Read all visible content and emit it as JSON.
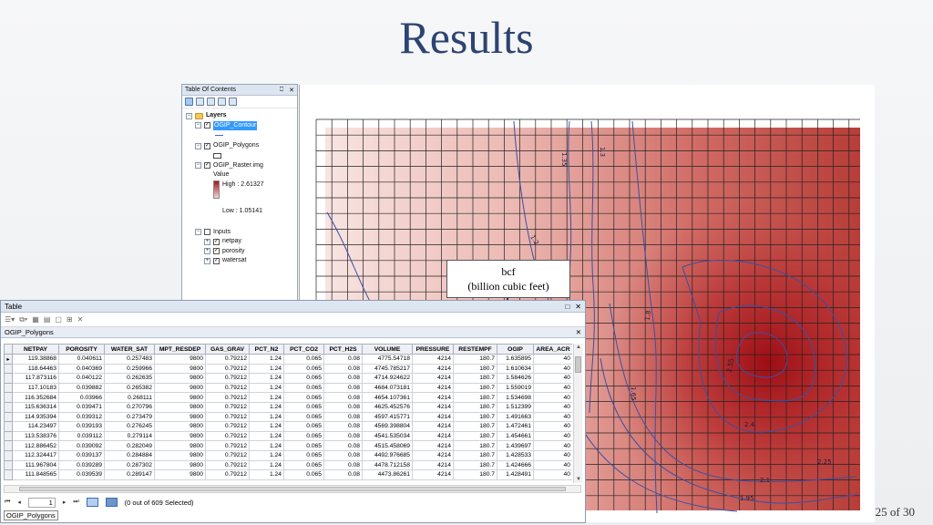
{
  "slide": {
    "title": "Results",
    "page_number": "25 of 30"
  },
  "toc": {
    "title": "Table Of Contents",
    "pin": "⎕",
    "close": "✕",
    "layers_label": "Layers",
    "layer1": "OGIP_Contour",
    "layer2": "OGIP_Polygons",
    "layer3": "OGIP_Raster.img",
    "value_label": "Value",
    "high_label": "High : 2.61327",
    "low_label": "Low : 1.05141",
    "inputs_label": "Inputs",
    "input1": "netpay",
    "input2": "porosity",
    "input3": "watersat"
  },
  "callout": {
    "line1": "bcf",
    "line2": "(billion cubic feet)"
  },
  "map": {
    "colors": {
      "light": "#f6e0dd",
      "dark": "#a5131a",
      "contour": "#3c4fa3",
      "grid": "#222222"
    },
    "contour_labels": [
      "1.35",
      "1.3",
      "1.2",
      "1.8",
      "1.65",
      "2.55",
      "2.4",
      "2.25",
      "2.1",
      "1.95"
    ]
  },
  "table": {
    "window_title": "Table",
    "close": "✕",
    "maximize": "□",
    "layer_tab": "OGIP_Polygons",
    "columns": [
      "",
      "NETPAY",
      "POROSITY",
      "WATER_SAT",
      "MPT_RESDEP",
      "GAS_GRAV",
      "PCT_N2",
      "PCT_CO2",
      "PCT_H2S",
      "VOLUME",
      "PRESSURE",
      "RESTEMPF",
      "OGIP",
      "AREA_ACR"
    ],
    "rows": [
      [
        "▸",
        "119.38868",
        "0.040611",
        "0.257483",
        "9800",
        "0.79212",
        "1.24",
        "0.065",
        "0.08",
        "4775.54718",
        "4214",
        "180.7",
        "1.635895",
        "40"
      ],
      [
        "",
        "118.64463",
        "0.040369",
        "0.259966",
        "9800",
        "0.79212",
        "1.24",
        "0.065",
        "0.08",
        "4745.785217",
        "4214",
        "180.7",
        "1.610634",
        "40"
      ],
      [
        "",
        "117.873116",
        "0.040122",
        "0.262635",
        "9800",
        "0.79212",
        "1.24",
        "0.065",
        "0.08",
        "4714.924622",
        "4214",
        "180.7",
        "1.584626",
        "40"
      ],
      [
        "",
        "117.10183",
        "0.039882",
        "0.265382",
        "9800",
        "0.79212",
        "1.24",
        "0.065",
        "0.08",
        "4684.073181",
        "4214",
        "180.7",
        "1.559019",
        "40"
      ],
      [
        "",
        "116.352684",
        "0.03966",
        "0.268111",
        "9800",
        "0.79212",
        "1.24",
        "0.065",
        "0.08",
        "4654.107361",
        "4214",
        "180.7",
        "1.534698",
        "40"
      ],
      [
        "",
        "115.636314",
        "0.039471",
        "0.270796",
        "9800",
        "0.79212",
        "1.24",
        "0.065",
        "0.08",
        "4625.452576",
        "4214",
        "180.7",
        "1.512399",
        "40"
      ],
      [
        "",
        "114.935394",
        "0.039312",
        "0.273479",
        "9800",
        "0.79212",
        "1.24",
        "0.065",
        "0.08",
        "4597.415771",
        "4214",
        "180.7",
        "1.491663",
        "40"
      ],
      [
        "",
        "114.23497",
        "0.039193",
        "0.276245",
        "9800",
        "0.79212",
        "1.24",
        "0.065",
        "0.08",
        "4569.398804",
        "4214",
        "180.7",
        "1.472461",
        "40"
      ],
      [
        "",
        "113.538376",
        "0.039112",
        "0.279114",
        "9800",
        "0.79212",
        "1.24",
        "0.065",
        "0.08",
        "4541.535034",
        "4214",
        "180.7",
        "1.454661",
        "40"
      ],
      [
        "",
        "112.886452",
        "0.039092",
        "0.282049",
        "9800",
        "0.79212",
        "1.24",
        "0.065",
        "0.08",
        "4515.458069",
        "4214",
        "180.7",
        "1.439697",
        "40"
      ],
      [
        "",
        "112.324417",
        "0.039137",
        "0.284884",
        "9800",
        "0.79212",
        "1.24",
        "0.065",
        "0.08",
        "4492.976685",
        "4214",
        "180.7",
        "1.428533",
        "40"
      ],
      [
        "",
        "111.967804",
        "0.039289",
        "0.287302",
        "9800",
        "0.79212",
        "1.24",
        "0.065",
        "0.08",
        "4478.712158",
        "4214",
        "180.7",
        "1.424666",
        "40"
      ],
      [
        "",
        "111.848565",
        "0.039539",
        "0.289147",
        "9800",
        "0.79212",
        "1.24",
        "0.065",
        "0.08",
        "4473.86261",
        "4214",
        "180.7",
        "1.428491",
        "40"
      ]
    ],
    "record_number": "1",
    "selection_status": "(0 out of 609 Selected)",
    "bottom_tab": "OGIP_Polygons"
  }
}
